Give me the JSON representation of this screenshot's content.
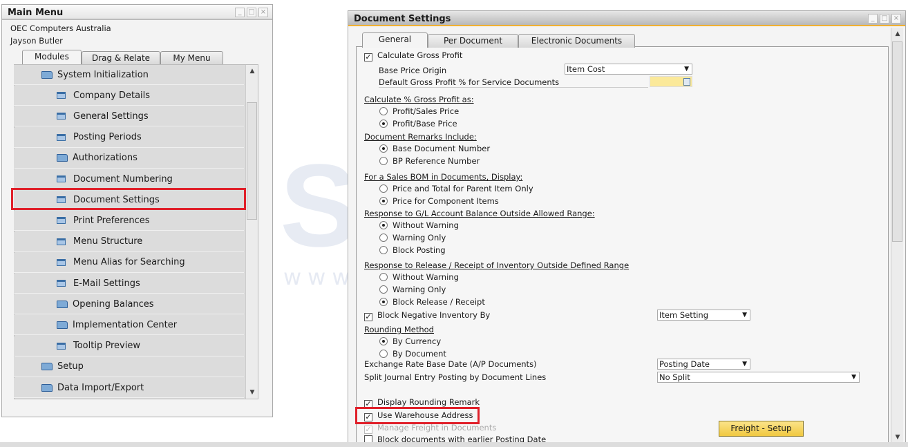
{
  "main_menu": {
    "title": "Main Menu",
    "company": "OEC Computers Australia",
    "user": "Jayson Butler",
    "tabs": [
      "Modules",
      "Drag & Relate",
      "My Menu"
    ],
    "active_tab": "Modules",
    "items": [
      {
        "label": "System Initialization",
        "type": "folder-open"
      },
      {
        "label": "Company Details",
        "type": "form"
      },
      {
        "label": "General Settings",
        "type": "form"
      },
      {
        "label": "Posting Periods",
        "type": "form"
      },
      {
        "label": "Authorizations",
        "type": "folder"
      },
      {
        "label": "Document Numbering",
        "type": "form"
      },
      {
        "label": "Document Settings",
        "type": "form",
        "highlighted": true
      },
      {
        "label": "Print Preferences",
        "type": "form"
      },
      {
        "label": "Menu Structure",
        "type": "form"
      },
      {
        "label": "Menu Alias for Searching",
        "type": "form"
      },
      {
        "label": "E-Mail Settings",
        "type": "form"
      },
      {
        "label": "Opening Balances",
        "type": "folder"
      },
      {
        "label": "Implementation Center",
        "type": "folder"
      },
      {
        "label": "Tooltip Preview",
        "type": "form"
      },
      {
        "label": "Setup",
        "type": "folder"
      },
      {
        "label": "Data Import/Export",
        "type": "folder"
      }
    ]
  },
  "doc_settings": {
    "title": "Document Settings",
    "tabs": [
      "General",
      "Per Document",
      "Electronic Documents"
    ],
    "active_tab": "General",
    "calc_gross_profit": "Calculate Gross Profit",
    "base_price_origin": "Base Price Origin",
    "base_price_origin_value": "Item Cost",
    "default_gp_service": "Default Gross Profit % for Service Documents",
    "default_gp_value": "",
    "calc_pct_heading": "Calculate % Gross Profit as:",
    "calc_pct_opts": [
      "Profit/Sales Price",
      "Profit/Base Price"
    ],
    "remarks_heading": "Document Remarks Include:",
    "remarks_opts": [
      "Base Document Number",
      "BP Reference Number"
    ],
    "bom_heading": "For a Sales BOM in Documents, Display:",
    "bom_opts": [
      "Price and Total for Parent Item Only",
      "Price for Component Items"
    ],
    "gl_heading": "Response to G/L Account Balance Outside Allowed Range:",
    "gl_opts": [
      "Without Warning",
      "Warning Only",
      "Block Posting"
    ],
    "inv_heading": "Response to Release / Receipt of Inventory Outside Defined Range",
    "inv_opts": [
      "Without Warning",
      "Warning Only",
      "Block Release / Receipt"
    ],
    "block_neg_inv": "Block Negative Inventory By",
    "block_neg_inv_value": "Item Setting",
    "rounding_heading": "Rounding Method",
    "rounding_opts": [
      "By Currency",
      "By Document"
    ],
    "exch_rate": "Exchange Rate Base Date (A/P Documents)",
    "exch_rate_value": "Posting Date",
    "split_je": "Split Journal Entry Posting by Document Lines",
    "split_je_value": "No Split",
    "display_rounding": "Display Rounding Remark",
    "use_warehouse": "Use Warehouse Address",
    "manage_freight": "Manage Freight in Documents",
    "block_earlier": "Block documents with earlier Posting Date",
    "freight_button": "Freight - Setup"
  },
  "watermark": {
    "logo": "STEM",
    "url": "www.sterling-team.com"
  },
  "colors": {
    "highlight": "#e0202a",
    "title_accent": "#f0b030",
    "button": "#f0c840",
    "input_yellow": "#fbe99a"
  }
}
